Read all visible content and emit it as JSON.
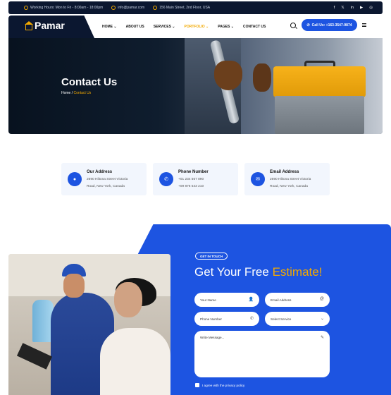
{
  "topbar": {
    "hours": "Working Hours: Mon to Fri - 8:00am - 18:00pm",
    "email": "info@pamar.com",
    "address": "156 Main Street, 2nd Floor, USA",
    "social": [
      "f",
      "𝕏",
      "in",
      "▶",
      "◎"
    ]
  },
  "header": {
    "logo": "Pamar",
    "nav": [
      "HOME ⌄",
      "ABOUT US",
      "SERVICES ⌄",
      "PORTFOLIO ⌄",
      "PAGES ⌄",
      "CONTACT US"
    ],
    "call_label": "Call Us: +163-3547-9874"
  },
  "hero": {
    "title": "Contact Us",
    "crumb_home": "Home",
    "crumb_sep": " / ",
    "crumb_current": "Contact Us"
  },
  "cards": [
    {
      "title": "Our Address",
      "line1": "2690 Hiltona Street Victoria",
      "line2": "Road, New York, Canada"
    },
    {
      "title": "Phone Number",
      "line1": "+01 234 567 890",
      "line2": "+09 876 543 210"
    },
    {
      "title": "Email Address",
      "line1": "2690 Hiltona Street Victoria",
      "line2": "Road, New York, Canada"
    }
  ],
  "form": {
    "badge": "GET IN TOUCH",
    "heading_plain": "Get Your Free ",
    "heading_highlight": "Estimate!",
    "name_placeholder": "Your Name",
    "email_placeholder": "Email Address",
    "phone_placeholder": "Phone Number",
    "service_placeholder": "Select Service",
    "message_placeholder": "Write Message...",
    "agree_label": "I agree with the privacy policy"
  },
  "colors": {
    "navy": "#0b1730",
    "accent_blue": "#1d54e1",
    "accent_yellow": "#f2a900"
  }
}
